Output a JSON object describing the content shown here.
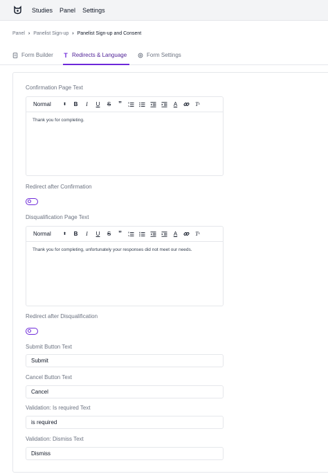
{
  "topnav": {
    "items": [
      "Studies",
      "Panel",
      "Settings"
    ]
  },
  "breadcrumb": {
    "items": [
      "Panel",
      "Panelist Sign-up",
      "Panelist Sign-up and Consent"
    ]
  },
  "tabs": [
    {
      "label": "Form Builder",
      "icon": "document-icon",
      "active": false
    },
    {
      "label": "Redirects & Language",
      "icon": "text-icon",
      "active": true
    },
    {
      "label": "Form Settings",
      "icon": "gear-icon",
      "active": false
    }
  ],
  "accent_color": "#6d28d9",
  "toolbar": {
    "format_label": "Normal"
  },
  "confirmation": {
    "label": "Confirmation Page Text",
    "body": "Thank you for completing.",
    "redirect_label": "Redirect after Confirmation",
    "redirect_enabled": false
  },
  "disqualification": {
    "label": "Disqualification Page Text",
    "body": "Thank you for completing, unfortunately your responses did not meet our needs.",
    "redirect_label": "Redirect after Disqualification",
    "redirect_enabled": false
  },
  "fields": {
    "submit": {
      "label": "Submit Button Text",
      "value": "Submit"
    },
    "cancel": {
      "label": "Cancel Button Text",
      "value": "Cancel"
    },
    "required": {
      "label": "Validation: Is required Text",
      "value": "is required"
    },
    "dismiss": {
      "label": "Validation: Dismiss Text",
      "value": "Dismiss"
    }
  }
}
